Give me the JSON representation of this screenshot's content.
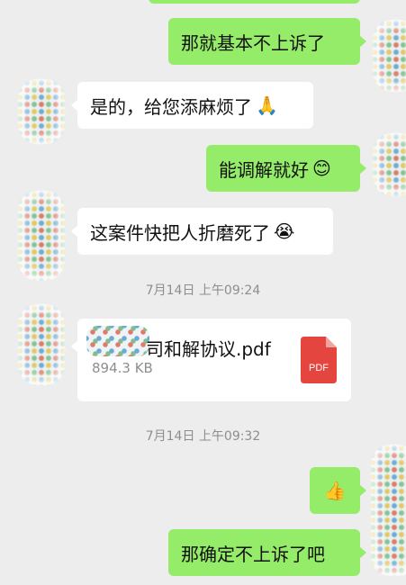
{
  "messages": [
    {
      "id": "m1",
      "side": "me",
      "text": "那就基本不上诉了",
      "emoji": ""
    },
    {
      "id": "m2",
      "side": "other",
      "text": "是的，给您添麻烦了",
      "emoji": "🙏"
    },
    {
      "id": "m3",
      "side": "me",
      "text": "能调解就好",
      "emoji": "😊"
    },
    {
      "id": "m4",
      "side": "other",
      "text": "这案件快把人折磨死了",
      "emoji": "😭"
    },
    {
      "id": "m5",
      "side": "me",
      "text": "",
      "emoji": "👍"
    },
    {
      "id": "m6",
      "side": "me",
      "text": "那确定不上诉了吧",
      "emoji": ""
    }
  ],
  "timestamps": [
    "7月14日 上午09:24",
    "7月14日 上午09:32"
  ],
  "file": {
    "name": "司和解协议.pdf",
    "size": "894.3 KB",
    "icon_label": "PDF",
    "icon_color": "#e4463f"
  },
  "colors": {
    "background": "#ededed",
    "my_bubble": "#95ec69",
    "other_bubble": "#ffffff"
  }
}
